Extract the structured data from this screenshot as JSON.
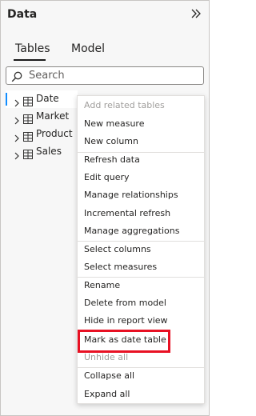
{
  "pane": {
    "title": "Data",
    "collapse_icon": "double-chevron-right-icon"
  },
  "tabs": [
    {
      "label": "Tables",
      "selected": true
    },
    {
      "label": "Model",
      "selected": false
    }
  ],
  "search": {
    "placeholder": "Search",
    "value": ""
  },
  "tables": [
    {
      "label": "Date",
      "selected": true
    },
    {
      "label": "Market",
      "selected": false
    },
    {
      "label": "Product",
      "selected": false
    },
    {
      "label": "Sales",
      "selected": false
    }
  ],
  "context_menu": {
    "groups": [
      [
        {
          "label": "Add related tables",
          "disabled": true
        },
        {
          "label": "New measure",
          "disabled": false
        },
        {
          "label": "New column",
          "disabled": false
        }
      ],
      [
        {
          "label": "Refresh data",
          "disabled": false
        },
        {
          "label": "Edit query",
          "disabled": false
        },
        {
          "label": "Manage relationships",
          "disabled": false
        },
        {
          "label": "Incremental refresh",
          "disabled": false
        },
        {
          "label": "Manage aggregations",
          "disabled": false
        }
      ],
      [
        {
          "label": "Select columns",
          "disabled": false
        },
        {
          "label": "Select measures",
          "disabled": false
        }
      ],
      [
        {
          "label": "Rename",
          "disabled": false
        },
        {
          "label": "Delete from model",
          "disabled": false
        },
        {
          "label": "Hide in report view",
          "disabled": false
        },
        {
          "label": "Mark as date table",
          "disabled": false,
          "highlighted": true
        },
        {
          "label": "Unhide all",
          "disabled": true
        }
      ],
      [
        {
          "label": "Collapse all",
          "disabled": false
        },
        {
          "label": "Expand all",
          "disabled": false
        }
      ]
    ]
  },
  "colors": {
    "accent": "#118dff",
    "highlight": "#e81123",
    "disabled_text": "#a19f9d"
  }
}
